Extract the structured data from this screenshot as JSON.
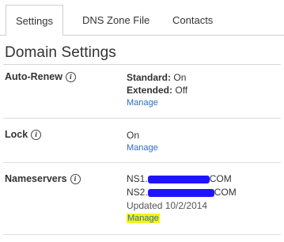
{
  "tabs": [
    {
      "label": "Settings",
      "active": true
    },
    {
      "label": "DNS Zone File",
      "active": false
    },
    {
      "label": "Contacts",
      "active": false
    }
  ],
  "page_title": "Domain Settings",
  "auto_renew": {
    "label": "Auto-Renew",
    "standard_label": "Standard:",
    "standard_value": "On",
    "extended_label": "Extended:",
    "extended_value": "Off",
    "manage": "Manage"
  },
  "lock": {
    "label": "Lock",
    "value": "On",
    "manage": "Manage"
  },
  "nameservers": {
    "label": "Nameservers",
    "ns1_prefix": "NS1.",
    "ns1_suffix": "COM",
    "ns2_prefix": "NS2.",
    "ns2_suffix": "COM",
    "updated": "Updated 10/2/2014",
    "manage": "Manage"
  },
  "colors": {
    "link": "#2a6ebb",
    "highlight": "#f7f30a",
    "redaction": "#1e14ff"
  },
  "icons": {
    "info": "info-circle-icon"
  }
}
